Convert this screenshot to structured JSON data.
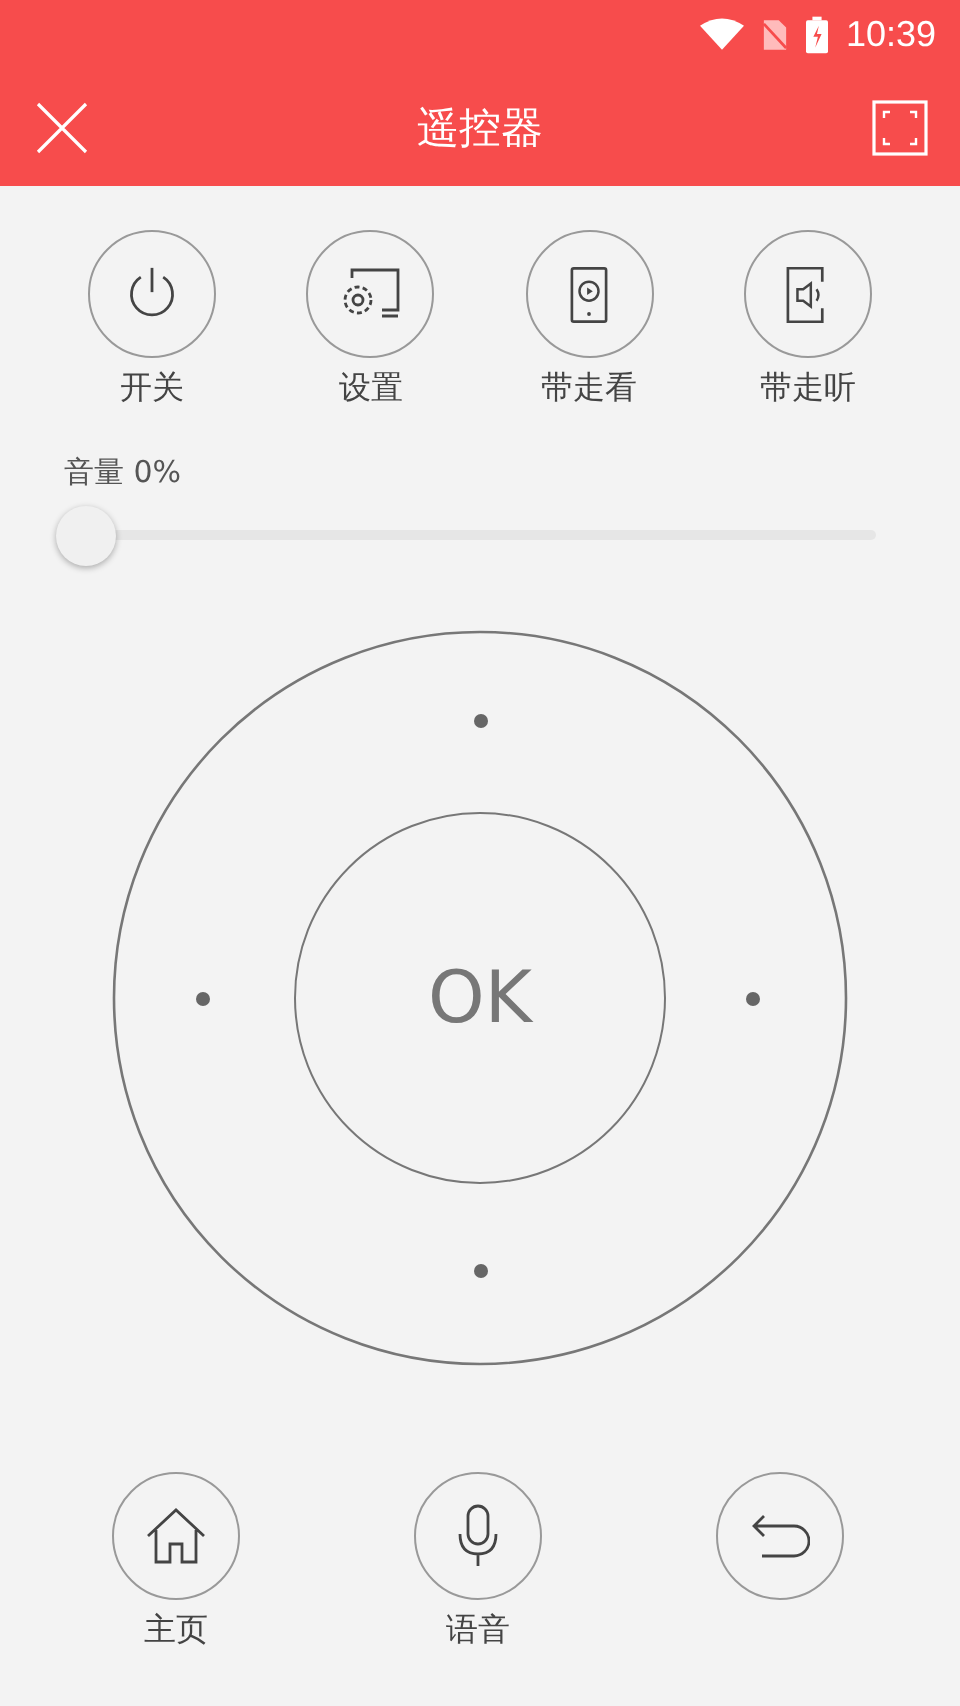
{
  "status_bar": {
    "time": "10:39"
  },
  "header": {
    "title": "遥控器"
  },
  "top_buttons": [
    {
      "kind": "power",
      "label": "开关"
    },
    {
      "kind": "settings",
      "label": "设置"
    },
    {
      "kind": "watch",
      "label": "带走看"
    },
    {
      "kind": "listen",
      "label": "带走听"
    }
  ],
  "volume": {
    "label": "音量 0%",
    "level": 0
  },
  "dpad": {
    "center_label": "OK"
  },
  "bottom_buttons": [
    {
      "kind": "home",
      "label": "主页"
    },
    {
      "kind": "voice",
      "label": "语音"
    },
    {
      "kind": "back"
    }
  ]
}
